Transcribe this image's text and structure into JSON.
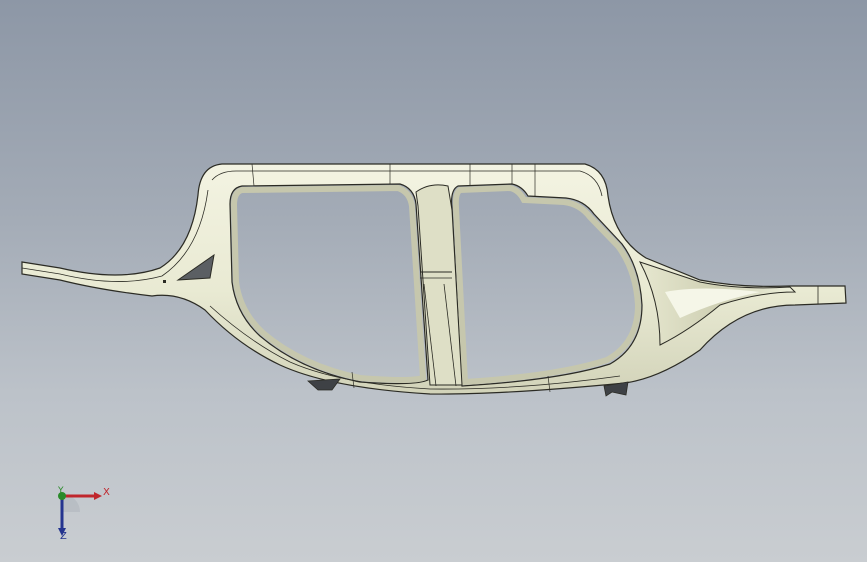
{
  "viewport": {
    "background_top": "#8d97a6",
    "background_bottom": "#c9cdd1"
  },
  "model": {
    "icon": "car-body-side-frame",
    "face_color": "#e9ead3",
    "shade_color": "#c6c7ad",
    "edge_color": "#2b2b24"
  },
  "triad": {
    "x_label": "X",
    "y_label": "Y",
    "z_label": "Z",
    "x_color": "#c0262c",
    "y_color": "#2a8a2a",
    "z_color": "#24348f"
  }
}
